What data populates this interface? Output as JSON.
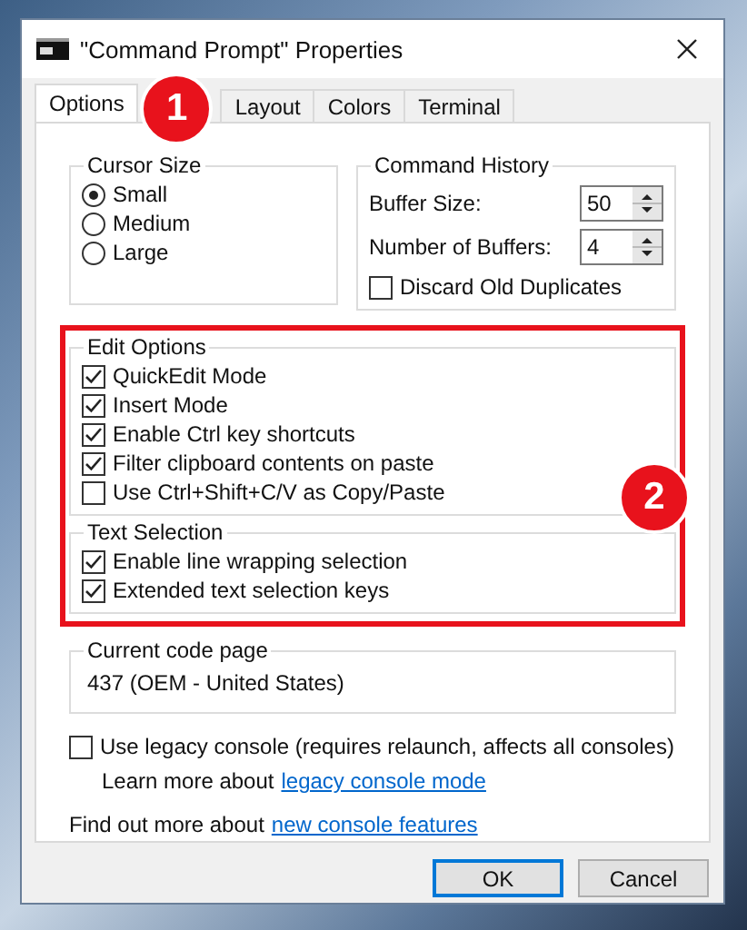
{
  "window": {
    "title": "\"Command Prompt\" Properties"
  },
  "tabs": [
    {
      "label": "Options",
      "selected": true
    },
    {
      "label": "Layout",
      "selected": false
    },
    {
      "label": "Colors",
      "selected": false
    },
    {
      "label": "Terminal",
      "selected": false
    }
  ],
  "cursor_size": {
    "title": "Cursor Size",
    "options": [
      {
        "label": "Small",
        "selected": true
      },
      {
        "label": "Medium",
        "selected": false
      },
      {
        "label": "Large",
        "selected": false
      }
    ]
  },
  "command_history": {
    "title": "Command History",
    "buffer_size": {
      "label": "Buffer Size:",
      "value": "50"
    },
    "number_of_buffers": {
      "label": "Number of Buffers:",
      "value": "4"
    },
    "discard_old_duplicates": {
      "label": "Discard Old Duplicates",
      "checked": false
    }
  },
  "edit_options": {
    "title": "Edit Options",
    "items": [
      {
        "label": "QuickEdit Mode",
        "checked": true
      },
      {
        "label": "Insert Mode",
        "checked": true
      },
      {
        "label": "Enable Ctrl key shortcuts",
        "checked": true
      },
      {
        "label": "Filter clipboard contents on paste",
        "checked": true
      },
      {
        "label": "Use Ctrl+Shift+C/V as Copy/Paste",
        "checked": false
      }
    ]
  },
  "text_selection": {
    "title": "Text Selection",
    "items": [
      {
        "label": "Enable line wrapping selection",
        "checked": true
      },
      {
        "label": "Extended text selection keys",
        "checked": true
      }
    ]
  },
  "current_code_page": {
    "title": "Current code page",
    "value": "437   (OEM - United States)"
  },
  "legacy_console": {
    "label": "Use legacy console (requires relaunch, affects all consoles)",
    "checked": false
  },
  "learn_more": {
    "text": "Learn more about",
    "link": "legacy console mode"
  },
  "find_out_more": {
    "text": "Find out more about",
    "link": "new console features"
  },
  "buttons": [
    {
      "label": "OK",
      "default": true
    },
    {
      "label": "Cancel",
      "default": false
    }
  ],
  "annotations": [
    {
      "label": "1"
    },
    {
      "label": "2"
    }
  ]
}
